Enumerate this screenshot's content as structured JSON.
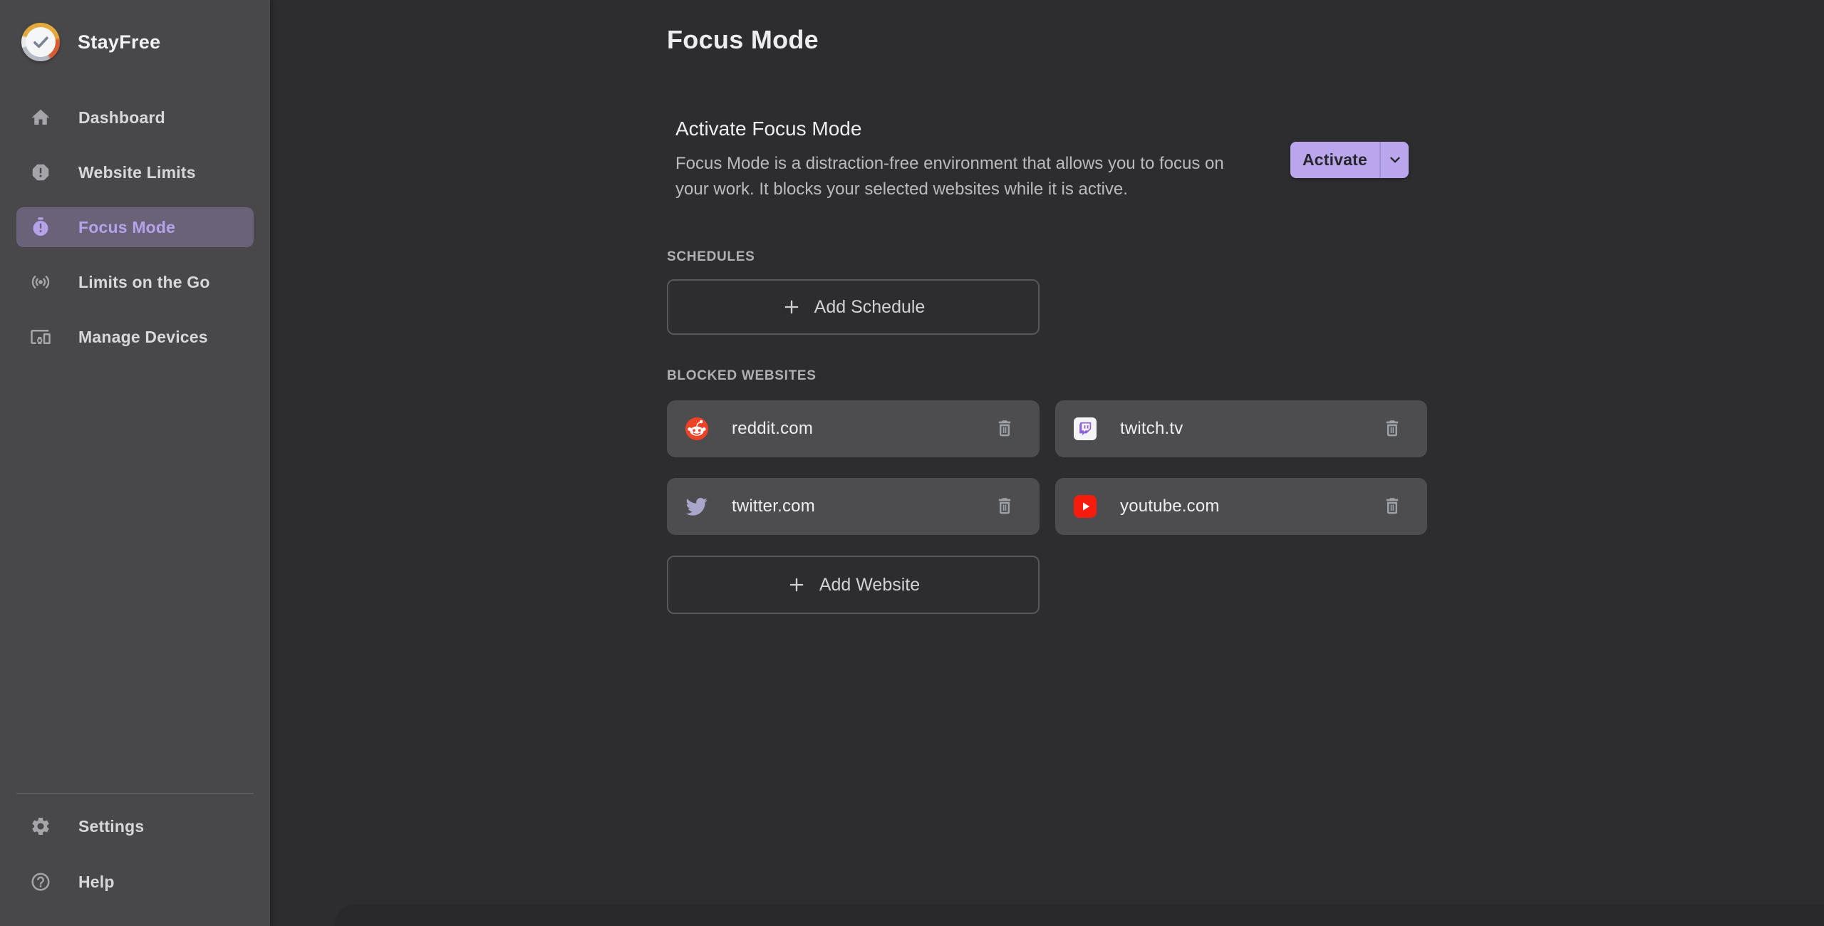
{
  "app": {
    "name": "StayFree",
    "logo_icon": "clock-check-logo"
  },
  "colors": {
    "accent_purple": "#b9a6ec",
    "active_nav_purple": "#b6a2e8",
    "sidebar_bg": "#48484a",
    "main_bg": "#2d2d2f",
    "card_bg": "#4d4d4f",
    "reddit_orange": "#ed4226",
    "twitch_purple": "#9146ff",
    "youtube_red": "#f61c0d",
    "twitter_muted": "#a9a6c9"
  },
  "sidebar": {
    "items": [
      {
        "label": "Dashboard",
        "icon": "home-icon",
        "active": false
      },
      {
        "label": "Website Limits",
        "icon": "alert-octagon-icon",
        "active": false
      },
      {
        "label": "Focus Mode",
        "icon": "timer-icon",
        "active": true
      },
      {
        "label": "Limits on the Go",
        "icon": "broadcast-icon",
        "active": false
      },
      {
        "label": "Manage Devices",
        "icon": "devices-icon",
        "active": false
      }
    ],
    "footer_items": [
      {
        "label": "Settings",
        "icon": "gear-icon"
      },
      {
        "label": "Help",
        "icon": "help-circle-icon"
      }
    ]
  },
  "header": {
    "title": "Focus Mode"
  },
  "activate_section": {
    "heading": "Activate Focus Mode",
    "description_lines": [
      "Focus Mode is a distraction-free environment that allows you to focus on",
      "your work. It blocks your selected websites while it is active."
    ],
    "activate_button_label": "Activate",
    "caret_icon": "chevron-down-icon"
  },
  "schedules": {
    "label": "SCHEDULES",
    "add_button_label": "Add Schedule"
  },
  "blocked_websites": {
    "label": "BLOCKED WEBSITES",
    "sites": [
      {
        "name": "reddit.com",
        "icon": "reddit-icon"
      },
      {
        "name": "twitch.tv",
        "icon": "twitch-icon"
      },
      {
        "name": "twitter.com",
        "icon": "twitter-icon"
      },
      {
        "name": "youtube.com",
        "icon": "youtube-icon"
      }
    ],
    "add_button_label": "Add Website"
  }
}
